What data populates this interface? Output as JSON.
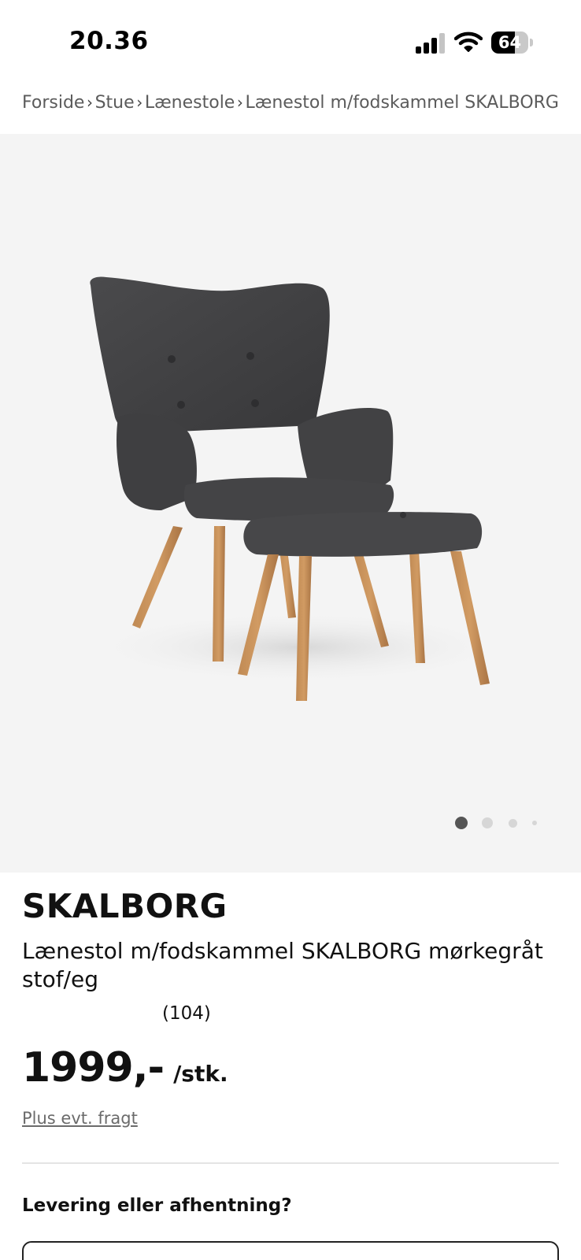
{
  "status_bar": {
    "time": "20.36",
    "battery_level": "64",
    "battery_fraction": 0.64
  },
  "breadcrumb": {
    "items": [
      "Forside",
      "Stue",
      "Lænestole",
      "Lænestol m/fodskammel SKALBORG"
    ]
  },
  "gallery": {
    "slide_count": 4,
    "active_slide": 1,
    "active_dot_color": "#555555",
    "inactive_dot_color": "#d6d6d6",
    "background_color": "#f4f4f4"
  },
  "product": {
    "brand": "SKALBORG",
    "description": "Lænestol m/fodskammel SKALBORG mørkegråt stof/eg",
    "review_count": "(104)",
    "price": "1999,-",
    "unit": "/stk.",
    "freight_link": "Plus evt. fragt"
  },
  "delivery": {
    "heading": "Levering eller afhentning?"
  }
}
